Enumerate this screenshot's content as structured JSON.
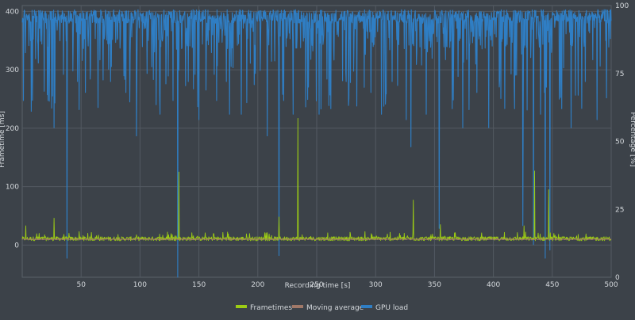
{
  "chart_data": {
    "type": "line",
    "xlabel": "Recording time [s]",
    "ylabel_left": "Frametime [ms]",
    "ylabel_right": "Percentage [%]",
    "xlim": [
      0,
      500
    ],
    "ylim_left": [
      -55,
      410
    ],
    "ylim_right": [
      0,
      100
    ],
    "x_ticks": [
      50,
      100,
      150,
      200,
      250,
      300,
      350,
      400,
      450,
      500
    ],
    "y_ticks_left": [
      0,
      100,
      200,
      300,
      400
    ],
    "y_ticks_right": [
      0,
      25,
      50,
      75,
      100
    ],
    "grid": true,
    "legend_position": "bottom-center",
    "series": [
      {
        "name": "Frametimes",
        "axis": "left",
        "color": "#9ccc14",
        "baseline": 11,
        "spikes": [
          [
            3,
            33
          ],
          [
            27,
            46
          ],
          [
            133,
            125
          ],
          [
            218,
            48
          ],
          [
            234,
            217
          ],
          [
            332,
            77
          ],
          [
            355,
            35
          ],
          [
            426,
            33
          ],
          [
            435,
            127
          ],
          [
            447,
            95
          ]
        ]
      },
      {
        "name": "Moving average",
        "axis": "left",
        "color": "#a07868",
        "baseline": 10
      },
      {
        "name": "GPU load",
        "axis": "right",
        "color": "#2f7ec4",
        "baseline": 96,
        "dips": [
          [
            1,
            65
          ],
          [
            8,
            80
          ],
          [
            22,
            65
          ],
          [
            27,
            55
          ],
          [
            38,
            7
          ],
          [
            47,
            72
          ],
          [
            58,
            78
          ],
          [
            66,
            80
          ],
          [
            75,
            72
          ],
          [
            88,
            68
          ],
          [
            97,
            52
          ],
          [
            106,
            75
          ],
          [
            117,
            60
          ],
          [
            128,
            65
          ],
          [
            132,
            0
          ],
          [
            141,
            72
          ],
          [
            150,
            58
          ],
          [
            165,
            65
          ],
          [
            176,
            60
          ],
          [
            186,
            60
          ],
          [
            198,
            75
          ],
          [
            208,
            52
          ],
          [
            218,
            8
          ],
          [
            222,
            65
          ],
          [
            230,
            60
          ],
          [
            243,
            70
          ],
          [
            252,
            60
          ],
          [
            262,
            62
          ],
          [
            275,
            72
          ],
          [
            284,
            63
          ],
          [
            296,
            68
          ],
          [
            305,
            60
          ],
          [
            314,
            72
          ],
          [
            326,
            58
          ],
          [
            330,
            48
          ],
          [
            343,
            60
          ],
          [
            354,
            18
          ],
          [
            365,
            62
          ],
          [
            374,
            55
          ],
          [
            386,
            68
          ],
          [
            396,
            55
          ],
          [
            405,
            70
          ],
          [
            418,
            62
          ],
          [
            425,
            19
          ],
          [
            434,
            12
          ],
          [
            440,
            60
          ],
          [
            444,
            7
          ],
          [
            448,
            10
          ],
          [
            458,
            62
          ],
          [
            466,
            55
          ],
          [
            478,
            72
          ],
          [
            488,
            58
          ],
          [
            496,
            66
          ]
        ]
      }
    ]
  }
}
